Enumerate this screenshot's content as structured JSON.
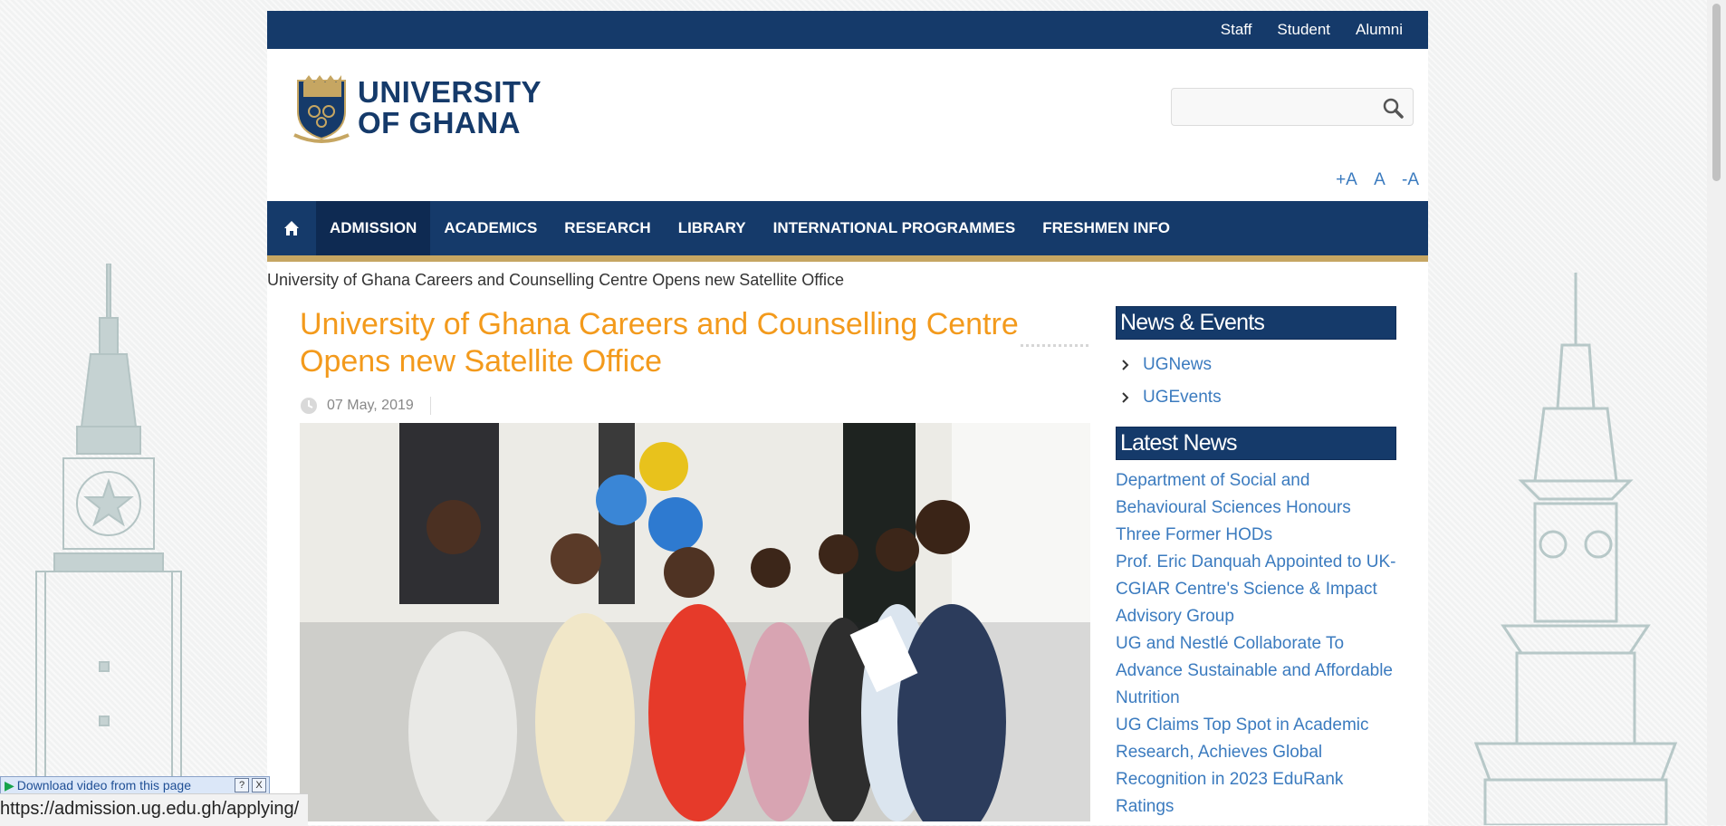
{
  "utility_nav": [
    "Staff",
    "Student",
    "Alumni"
  ],
  "logo": {
    "line1": "UNIVERSITY",
    "line2": "OF GHANA"
  },
  "search": {
    "placeholder": ""
  },
  "text_size": [
    "+A",
    "A",
    "-A"
  ],
  "main_nav": {
    "items": [
      "ADMISSION",
      "ACADEMICS",
      "RESEARCH",
      "LIBRARY",
      "INTERNATIONAL PROGRAMMES",
      "FRESHMEN INFO"
    ],
    "active": "ADMISSION"
  },
  "breadcrumb": "University of Ghana Careers and Counselling Centre Opens new Satellite Office",
  "article": {
    "title": "University of Ghana Careers and Counselling Centre Opens new Satellite Office",
    "date": "07 May, 2019"
  },
  "sidebar": {
    "news_events_heading": "News & Events",
    "links": [
      "UGNews",
      "UGEvents"
    ],
    "latest_heading": "Latest News",
    "latest": [
      "Department of Social and Behavioural Sciences Honours Three Former HODs",
      "Prof. Eric Danquah Appointed to UK-CGIAR Centre's Science & Impact Advisory Group",
      "UG and Nestlé Collaborate To Advance Sustainable and Affordable Nutrition",
      "UG Claims Top Spot in Academic Research, Achieves Global Recognition in 2023 EduRank Ratings"
    ]
  },
  "download_bar": {
    "label": "Download video from this page",
    "help": "?",
    "close": "X"
  },
  "status_url": "https://admission.ug.edu.gh/applying/",
  "colors": {
    "navy": "#153a6a",
    "gold": "#c6a662",
    "orange_title": "#f39a1c",
    "link_blue": "#3b7bbf"
  }
}
